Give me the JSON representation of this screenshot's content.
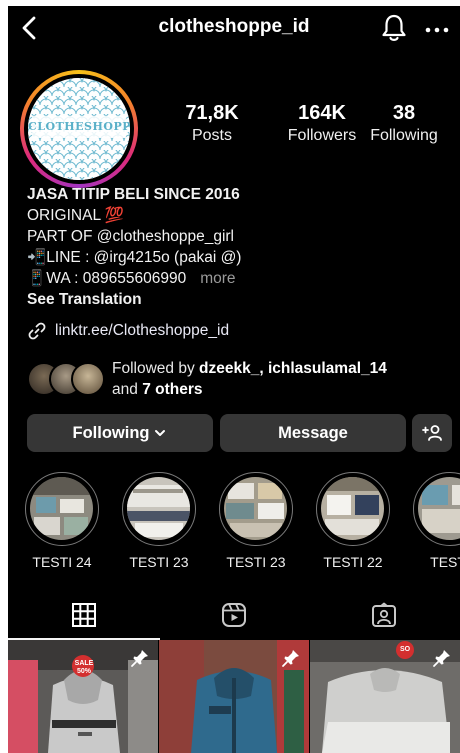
{
  "header": {
    "username": "clotheshoppe_id",
    "back_icon": "chevron-left-icon",
    "bell_icon": "bell-icon",
    "more_icon": "more-horizontal-icon"
  },
  "profile": {
    "avatar_logo_text": "CLOTHESHOPPE",
    "stats": [
      {
        "value": "71,8K",
        "label": "Posts"
      },
      {
        "value": "164K",
        "label": "Followers"
      },
      {
        "value": "38",
        "label": "Following"
      }
    ]
  },
  "bio": {
    "title": "JASA TITIP BELI SINCE 2016",
    "line1": "ORIGINAL 💯",
    "line2": "PART OF @clotheshoppe_girl",
    "line3": "📲LINE : @irg4215o (pakai @)",
    "line4": "📱WA : 089655606990",
    "more": "more",
    "see_translation": "See Translation",
    "link": "linktr.ee/Clotheshoppe_id"
  },
  "followed_by": {
    "prefix": "Followed by",
    "users": "dzeekk_, ichlasulamal_14",
    "and": "and",
    "others": "7 others"
  },
  "buttons": {
    "following": "Following",
    "message": "Message"
  },
  "highlights": [
    {
      "label": "TESTI 24"
    },
    {
      "label": "TESTI 23"
    },
    {
      "label": "TESTI 23"
    },
    {
      "label": "TESTI 22"
    },
    {
      "label": "TESTI"
    }
  ],
  "tabs": [
    {
      "name": "grid",
      "icon": "grid-icon",
      "active": true
    },
    {
      "name": "reels",
      "icon": "reels-icon",
      "active": false
    },
    {
      "name": "tagged",
      "icon": "tagged-person-icon",
      "active": false
    }
  ],
  "posts": [
    {
      "badge": "SALE 50%",
      "pinned": true
    },
    {
      "pinned": true
    },
    {
      "badge": "SO",
      "pinned": true
    }
  ],
  "colors": {
    "background": "#000000",
    "button_bg": "#363636",
    "story_ring": [
      "#f7c21a",
      "#f58529",
      "#dd2a7b",
      "#a334c0"
    ],
    "muted_text": "#9a9a9a"
  }
}
